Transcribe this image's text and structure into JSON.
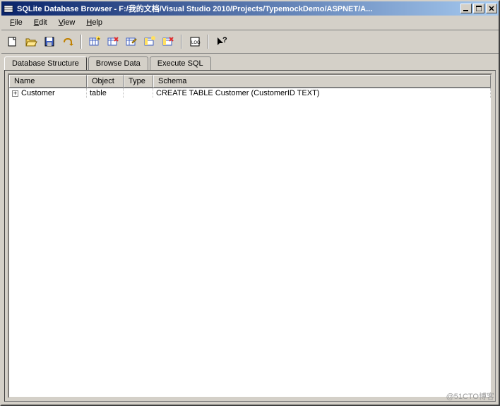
{
  "title": "SQLite Database Browser - F:/我的文档/Visual Studio 2010/Projects/TypemockDemo/ASPNET/A...",
  "menu": {
    "file": "File",
    "edit": "Edit",
    "view": "View",
    "help": "Help"
  },
  "tabs": {
    "structure": "Database Structure",
    "browse": "Browse Data",
    "execute": "Execute SQL"
  },
  "grid": {
    "headers": {
      "name": "Name",
      "object": "Object",
      "type": "Type",
      "schema": "Schema"
    },
    "rows": [
      {
        "name": "Customer",
        "object": "table",
        "type": "",
        "schema": "CREATE TABLE Customer (CustomerID TEXT)"
      }
    ]
  },
  "watermark": "@51CTO博客"
}
